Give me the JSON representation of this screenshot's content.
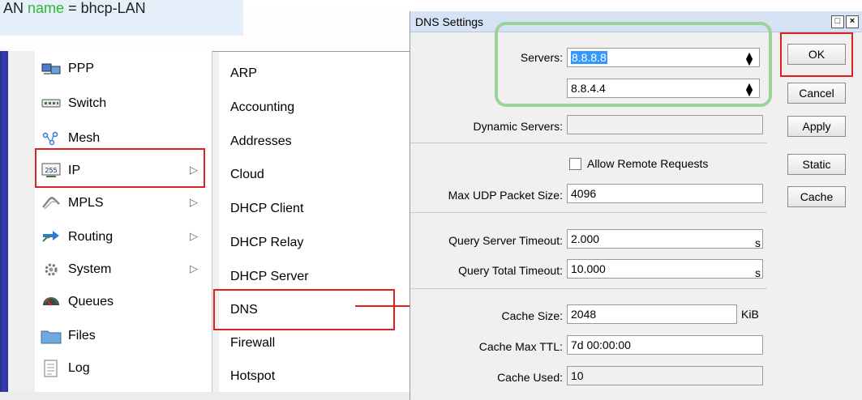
{
  "caption": {
    "prefix": "AN",
    "keyword": "name",
    "suffix": "= bhcp-LAN"
  },
  "menu": {
    "items": [
      {
        "label": "PPP",
        "icon": "ppp-icon",
        "submenu": false
      },
      {
        "label": "Switch",
        "icon": "switch-icon",
        "submenu": false
      },
      {
        "label": "Mesh",
        "icon": "mesh-icon",
        "submenu": false
      },
      {
        "label": "IP",
        "icon": "ip-icon",
        "submenu": true
      },
      {
        "label": "MPLS",
        "icon": "mpls-icon",
        "submenu": true
      },
      {
        "label": "Routing",
        "icon": "routing-icon",
        "submenu": true
      },
      {
        "label": "System",
        "icon": "system-icon",
        "submenu": true
      },
      {
        "label": "Queues",
        "icon": "queues-icon",
        "submenu": false
      },
      {
        "label": "Files",
        "icon": "files-icon",
        "submenu": false
      },
      {
        "label": "Log",
        "icon": "log-icon",
        "submenu": false
      }
    ]
  },
  "submenu": {
    "items": [
      "ARP",
      "Accounting",
      "Addresses",
      "Cloud",
      "DHCP Client",
      "DHCP Relay",
      "DHCP Server",
      "DNS",
      "Firewall",
      "Hotspot"
    ]
  },
  "dialog": {
    "title": "DNS Settings",
    "title_buttons": [
      "□",
      "×"
    ],
    "servers_label": "Servers:",
    "server1": "8.8.8.8",
    "server2": "8.8.4.4",
    "dynamic_servers_label": "Dynamic Servers:",
    "dynamic_servers_value": "",
    "allow_remote_label": "Allow Remote Requests",
    "allow_remote_checked": false,
    "max_udp_label": "Max UDP Packet Size:",
    "max_udp_value": "4096",
    "query_server_timeout_label": "Query Server Timeout:",
    "query_server_timeout_value": "2.000",
    "query_total_timeout_label": "Query Total Timeout:",
    "query_total_timeout_value": "10.000",
    "seconds_unit": "s",
    "cache_size_label": "Cache Size:",
    "cache_size_value": "2048",
    "cache_size_unit": "KiB",
    "cache_max_ttl_label": "Cache Max TTL:",
    "cache_max_ttl_value": "7d 00:00:00",
    "cache_used_label": "Cache Used:",
    "cache_used_value": "10",
    "buttons": {
      "ok": "OK",
      "cancel": "Cancel",
      "apply": "Apply",
      "static": "Static",
      "cache": "Cache"
    }
  },
  "colors": {
    "highlight": "#e02020",
    "green_box": "#9bd39b",
    "selection": "#3399ff",
    "menu_bar": "#2c2f94"
  }
}
